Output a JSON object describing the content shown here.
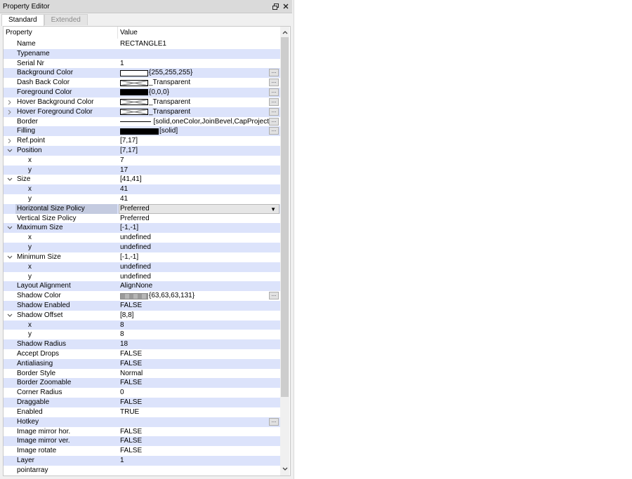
{
  "window": {
    "title": "Property Editor",
    "float_icon": "float-icon",
    "close_icon": "close-icon"
  },
  "tabs": [
    {
      "label": "Standard",
      "active": true
    },
    {
      "label": "Extended",
      "active": false
    }
  ],
  "header": {
    "property": "Property",
    "value": "Value"
  },
  "rows": [
    {
      "name": "Name",
      "value": "RECTANGLE1"
    },
    {
      "name": "Typename",
      "value": ""
    },
    {
      "name": "Serial Nr",
      "value": "1"
    },
    {
      "name": "Background Color",
      "value": "{255,255,255}",
      "swatch": "white",
      "button": true
    },
    {
      "name": "Dash Back Color",
      "value": "_Transparent",
      "swatch": "transp",
      "button": true
    },
    {
      "name": "Foreground Color",
      "value": "{0,0,0}",
      "swatch": "black",
      "button": true
    },
    {
      "name": "Hover Background Color",
      "value": "_Transparent",
      "swatch": "transp",
      "button": true,
      "expander": "collapsed"
    },
    {
      "name": "Hover Foreground Color",
      "value": "_Transparent",
      "swatch": "transp",
      "button": true,
      "expander": "collapsed"
    },
    {
      "name": "Border",
      "value": "[solid,oneColor,JoinBevel,CapProject",
      "swatch": "line",
      "button": true
    },
    {
      "name": "Filling",
      "value": "[solid]",
      "swatch": "black-wide",
      "button": true
    },
    {
      "name": "Ref.point",
      "value": "[7,17]",
      "expander": "collapsed"
    },
    {
      "name": "Position",
      "value": "[7,17]",
      "expander": "expanded"
    },
    {
      "name": "x",
      "value": "7",
      "child": true
    },
    {
      "name": "y",
      "value": "17",
      "child": true
    },
    {
      "name": "Size",
      "value": "[41,41]",
      "expander": "expanded"
    },
    {
      "name": "x",
      "value": "41",
      "child": true
    },
    {
      "name": "y",
      "value": "41",
      "child": true
    },
    {
      "name": "Horizontal Size Policy",
      "value": "Preferred",
      "selected": true,
      "dropdown": true
    },
    {
      "name": "Vertical Size Policy",
      "value": "Preferred"
    },
    {
      "name": "Maximum Size",
      "value": "[-1,-1]",
      "expander": "expanded"
    },
    {
      "name": "x",
      "value": "undefined",
      "child": true
    },
    {
      "name": "y",
      "value": "undefined",
      "child": true
    },
    {
      "name": "Minimum Size",
      "value": "[-1,-1]",
      "expander": "expanded"
    },
    {
      "name": "x",
      "value": "undefined",
      "child": true
    },
    {
      "name": "y",
      "value": "undefined",
      "child": true
    },
    {
      "name": "Layout Alignment",
      "value": "AlignNone"
    },
    {
      "name": "Shadow Color",
      "value": "{63,63,63,131}",
      "swatch": "shadow",
      "button": true
    },
    {
      "name": "Shadow Enabled",
      "value": "FALSE"
    },
    {
      "name": "Shadow Offset",
      "value": "[8,8]",
      "expander": "expanded"
    },
    {
      "name": "x",
      "value": "8",
      "child": true
    },
    {
      "name": "y",
      "value": "8",
      "child": true
    },
    {
      "name": "Shadow Radius",
      "value": "18"
    },
    {
      "name": "Accept Drops",
      "value": "FALSE"
    },
    {
      "name": "Antialiasing",
      "value": "FALSE"
    },
    {
      "name": "Border Style",
      "value": "Normal"
    },
    {
      "name": "Border Zoomable",
      "value": "FALSE"
    },
    {
      "name": "Corner Radius",
      "value": "0"
    },
    {
      "name": "Draggable",
      "value": "FALSE"
    },
    {
      "name": "Enabled",
      "value": "TRUE"
    },
    {
      "name": "Hotkey",
      "value": "",
      "button": true
    },
    {
      "name": "Image mirror hor.",
      "value": "FALSE"
    },
    {
      "name": "Image mirror ver.",
      "value": "FALSE"
    },
    {
      "name": "Image rotate",
      "value": "FALSE"
    },
    {
      "name": "Layer",
      "value": "1"
    },
    {
      "name": "pointarray",
      "value": ""
    }
  ],
  "button_label": "...",
  "colors": {
    "alt_row": "#dce3fb",
    "selected_name": "#c4cbe0"
  }
}
